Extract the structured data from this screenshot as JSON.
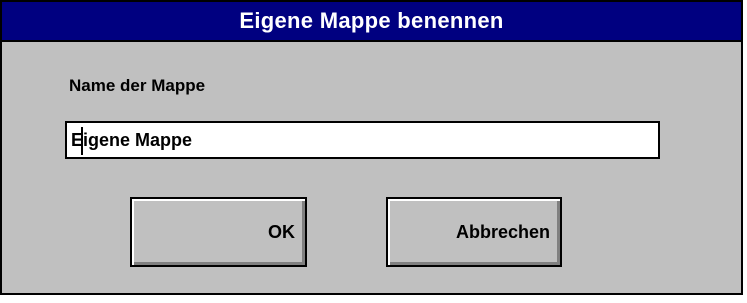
{
  "dialog": {
    "title": "Eigene Mappe benennen",
    "field_label": "Name der Mappe",
    "field_value": "Eigene Mappe",
    "ok_label": "OK",
    "cancel_label": "Abbrechen"
  },
  "colors": {
    "title_bar": "#000080",
    "dialog_background": "#c0c0c0",
    "field_background": "#ffffff"
  }
}
